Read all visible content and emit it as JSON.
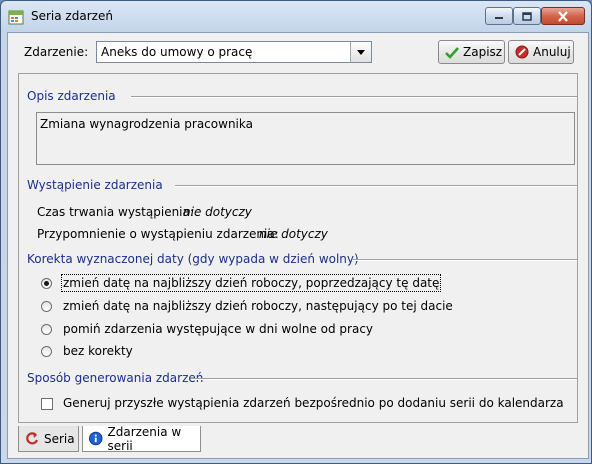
{
  "window": {
    "title": "Seria zdarzeń",
    "controls": [
      "minimize-icon",
      "maximize-icon",
      "close-icon"
    ]
  },
  "header": {
    "event_label": "Zdarzenie:",
    "event_value": "Aneks do umowy o pracę",
    "save_label": "Zapisz",
    "cancel_label": "Anuluj"
  },
  "description": {
    "title": "Opis zdarzenia",
    "text": "Zmiana wynagrodzenia pracownika"
  },
  "occurrence": {
    "title": "Wystąpienie zdarzenia",
    "duration_label": "Czas trwania wystąpienia:",
    "duration_value": "nie dotyczy",
    "reminder_label": "Przypomnienie o wystąpieniu zdarzenia:",
    "reminder_value": "nie dotyczy"
  },
  "correction": {
    "title": "Korekta wyznaczonej daty (gdy wypada w dzień wolny)",
    "options": [
      {
        "label": "zmień datę na najbliższy dzień roboczy, poprzedzający tę datę",
        "selected": true
      },
      {
        "label": "zmień datę na najbliższy dzień roboczy, następujący po tej dacie",
        "selected": false
      },
      {
        "label": "pomiń zdarzenia występujące w dni wolne od pracy",
        "selected": false
      },
      {
        "label": "bez korekty",
        "selected": false
      }
    ]
  },
  "generation": {
    "title": "Sposób generowania zdarzeń",
    "checkbox_label": "Generuj przyszłe wystąpienia zdarzeń bezpośrednio po dodaniu serii do kalendarza",
    "checked": false
  },
  "tabs": [
    {
      "label": "Seria",
      "icon": "series-icon",
      "active": false
    },
    {
      "label": "Zdarzenia w serii",
      "icon": "info-icon",
      "active": true
    }
  ],
  "colors": {
    "section_title": "#1c2f8a",
    "save_check": "#2fa12a",
    "cancel_icon": "#cc2a2a",
    "info_icon": "#1e62d0"
  }
}
